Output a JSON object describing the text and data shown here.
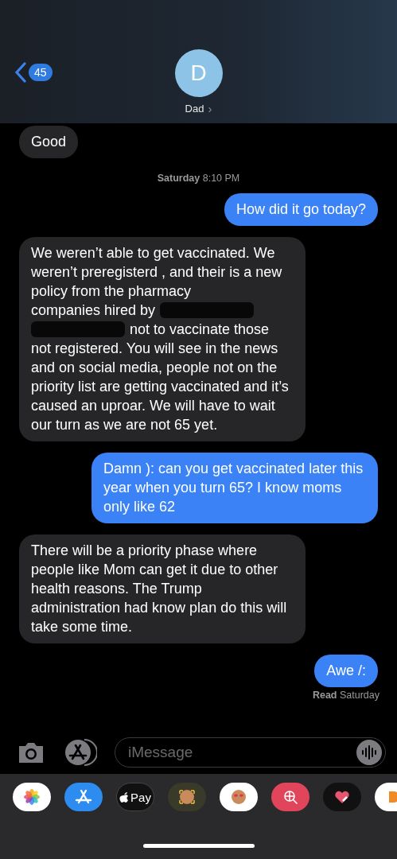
{
  "header": {
    "back_count": "45",
    "avatar_initial": "D",
    "contact_name": "Dad",
    "chevron": "›"
  },
  "messages": [
    {
      "kind": "received",
      "parts": [
        {
          "kind": "text",
          "text": "Good"
        }
      ]
    },
    {
      "kind": "timestamp",
      "day": "Saturday",
      "time": "8:10 PM"
    },
    {
      "kind": "sent",
      "parts": [
        {
          "kind": "text",
          "text": "How did it go today?"
        }
      ]
    },
    {
      "kind": "received",
      "parts": [
        {
          "kind": "text",
          "text": "We weren’t able to get vaccinated. We weren’t preregisterd , and their is a new policy from the pharmacy"
        },
        {
          "kind": "line",
          "items": [
            {
              "kind": "text",
              "text": "companies hired by"
            },
            {
              "kind": "redaction"
            }
          ]
        },
        {
          "kind": "line",
          "items": [
            {
              "kind": "redaction"
            },
            {
              "kind": "text",
              "text": "not to vaccinate those"
            }
          ]
        },
        {
          "kind": "text",
          "text": "not registered. You will see in the news and on social media, people not on the priority list are getting vaccinated and it’s caused an uproar. We will have to wait our turn as we are not 65 yet."
        }
      ]
    },
    {
      "kind": "sent",
      "parts": [
        {
          "kind": "text",
          "text": "Damn ): can you get vaccinated later this year when you turn 65? I know moms only like 62"
        }
      ]
    },
    {
      "kind": "received",
      "parts": [
        {
          "kind": "text",
          "text": "There will be a priority phase where people like Mom can get it due to other health reasons. The Trump administration had know plan do this will take some time."
        }
      ]
    },
    {
      "kind": "sent",
      "parts": [
        {
          "kind": "text",
          "text": "Awe /:"
        }
      ]
    },
    {
      "kind": "receipt",
      "status": "Read",
      "day": "Saturday"
    }
  ],
  "composer": {
    "placeholder": "iMessage"
  },
  "app_drawer": [
    {
      "kind": "photos"
    },
    {
      "kind": "appstore"
    },
    {
      "kind": "pay",
      "label": "Pay"
    },
    {
      "kind": "memoji"
    },
    {
      "kind": "stickers"
    },
    {
      "kind": "search"
    },
    {
      "kind": "heart"
    },
    {
      "kind": "partial"
    }
  ]
}
